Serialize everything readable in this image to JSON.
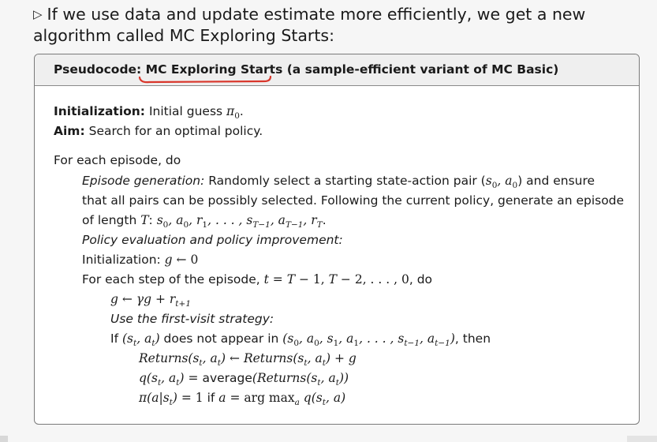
{
  "intro": {
    "bullet": "▷",
    "line1": "If we use data and update estimate more efficiently, we get a new",
    "line2": "algorithm called MC Exploring Starts:"
  },
  "box": {
    "title_prefix": "Pseudocode: ",
    "title_highlight": "MC Exploring Starts",
    "title_suffix": " (a sample-efficient variant of MC Basic)",
    "init_label": "Initialization:",
    "init_text": " Initial guess ",
    "init_math": "π",
    "aim_label": "Aim:",
    "aim_text": " Search for an optimal policy.",
    "for_each_episode": "For each episode, do",
    "gen_label": "Episode generation:",
    "gen_text1": " Randomly select a starting state-action pair (",
    "gen_text1b": ") and ensure",
    "gen_text2": "that all pairs can be possibly selected. Following the current policy, generate an episode",
    "gen_text3": "of length ",
    "policy_eval": "Policy evaluation and policy improvement:",
    "init2_label": "Initialization: ",
    "for_each_step": "For each step of the episode, ",
    "for_each_step_end": ", do",
    "first_visit": "Use the first-visit strategy:",
    "if_text": "If ",
    "not_appear": " does not appear in ",
    "then_text": ", then",
    "returns": "Returns",
    "average": "average",
    "if_word": " if ",
    "argmax": "arg max"
  }
}
